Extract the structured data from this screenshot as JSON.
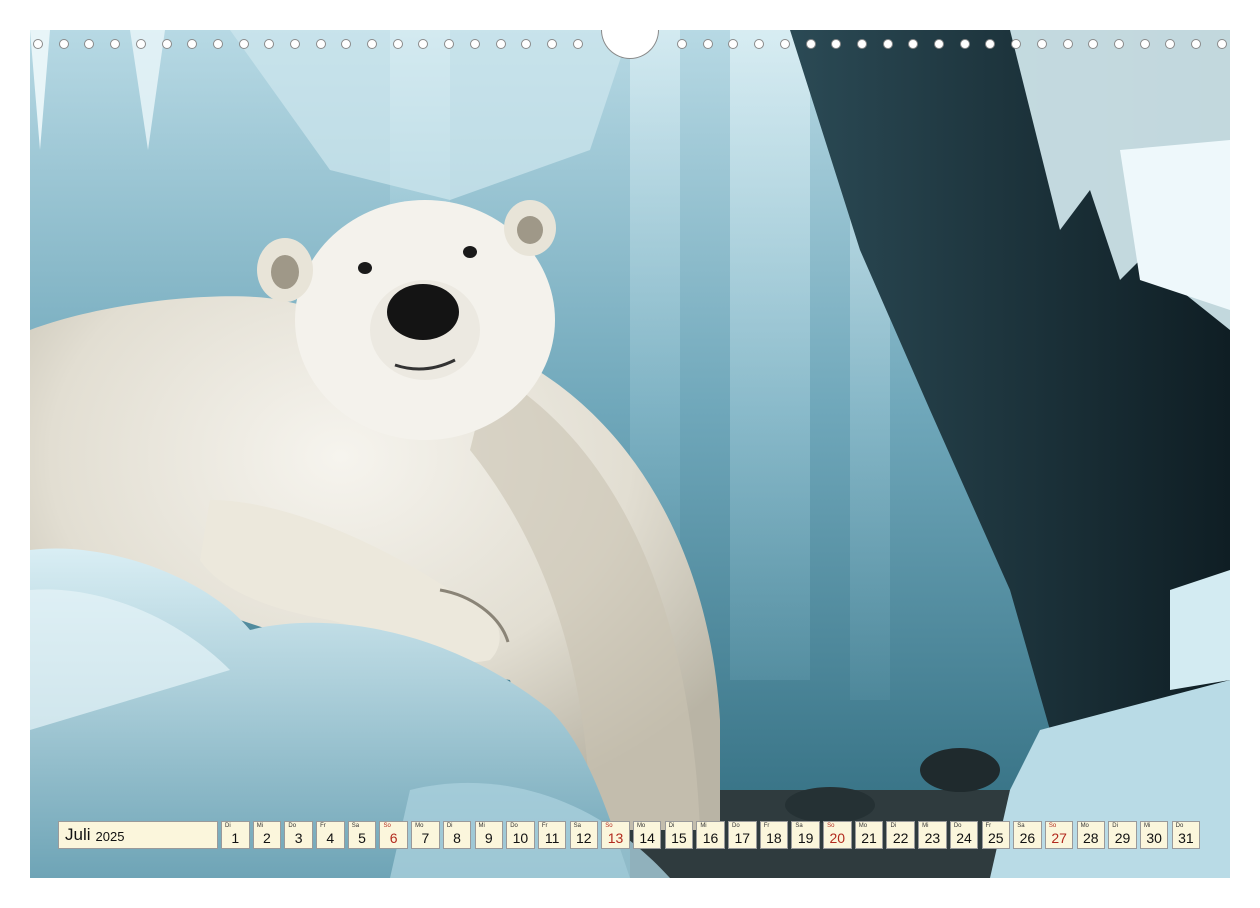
{
  "calendar": {
    "month": "Juli",
    "year": "2025",
    "days": [
      {
        "wd": "Di",
        "d": "1"
      },
      {
        "wd": "Mi",
        "d": "2"
      },
      {
        "wd": "Do",
        "d": "3"
      },
      {
        "wd": "Fr",
        "d": "4"
      },
      {
        "wd": "Sa",
        "d": "5"
      },
      {
        "wd": "So",
        "d": "6",
        "sunday": true
      },
      {
        "wd": "Mo",
        "d": "7"
      },
      {
        "wd": "Di",
        "d": "8"
      },
      {
        "wd": "Mi",
        "d": "9"
      },
      {
        "wd": "Do",
        "d": "10"
      },
      {
        "wd": "Fr",
        "d": "11"
      },
      {
        "wd": "Sa",
        "d": "12"
      },
      {
        "wd": "So",
        "d": "13",
        "sunday": true
      },
      {
        "wd": "Mo",
        "d": "14"
      },
      {
        "wd": "Di",
        "d": "15"
      },
      {
        "wd": "Mi",
        "d": "16"
      },
      {
        "wd": "Do",
        "d": "17"
      },
      {
        "wd": "Fr",
        "d": "18"
      },
      {
        "wd": "Sa",
        "d": "19"
      },
      {
        "wd": "So",
        "d": "20",
        "sunday": true
      },
      {
        "wd": "Mo",
        "d": "21"
      },
      {
        "wd": "Di",
        "d": "22"
      },
      {
        "wd": "Mi",
        "d": "23"
      },
      {
        "wd": "Do",
        "d": "24"
      },
      {
        "wd": "Fr",
        "d": "25"
      },
      {
        "wd": "Sa",
        "d": "26"
      },
      {
        "wd": "So",
        "d": "27",
        "sunday": true
      },
      {
        "wd": "Mo",
        "d": "28"
      },
      {
        "wd": "Di",
        "d": "29"
      },
      {
        "wd": "Mi",
        "d": "30"
      },
      {
        "wd": "Do",
        "d": "31"
      }
    ]
  },
  "colors": {
    "cell_bg": "#fbf6dc",
    "sunday": "#b22a1e",
    "ice": "#9cc7d6",
    "rock": "#14262d"
  }
}
